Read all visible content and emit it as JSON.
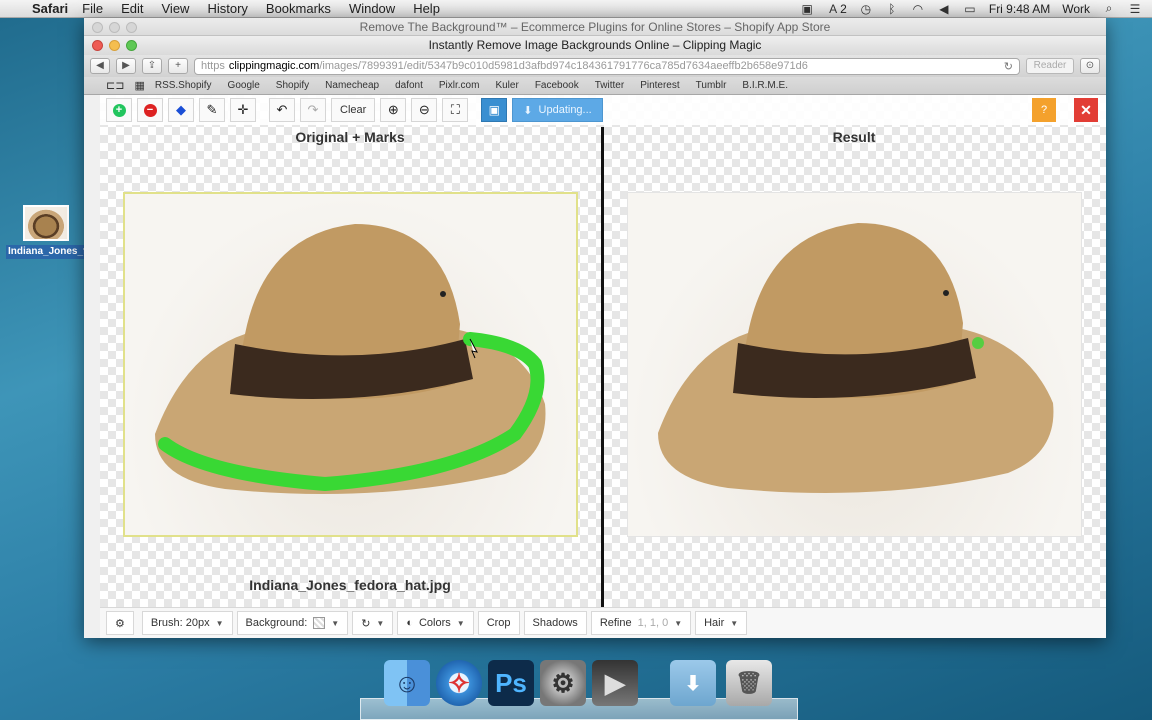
{
  "menubar": {
    "app": "Safari",
    "items": [
      "File",
      "Edit",
      "View",
      "History",
      "Bookmarks",
      "Window",
      "Help"
    ],
    "badge": "2",
    "clock": "Fri 9:48 AM",
    "user": "Work"
  },
  "desktop": {
    "file_label": "Indiana_Jones_fedora_hat.jpg"
  },
  "browser": {
    "background_title": "Remove The Background™ – Ecommerce Plugins for Online Stores – Shopify App Store",
    "window_title": "Instantly Remove Image Backgrounds Online – Clipping Magic",
    "url_scheme": "https",
    "url_host": "clippingmagic.com",
    "url_path": "/images/7899391/edit/5347b9c010d5981d3afbd974c184361791776ca785d7634aeeffb2b658e971d6",
    "reader_label": "Reader",
    "bookmarks": [
      "RSS.Shopify",
      "Google",
      "Shopify",
      "Namecheap",
      "dafont",
      "Pixlr.com",
      "Kuler",
      "Facebook",
      "Twitter",
      "Pinterest",
      "Tumblr",
      "B.I.R.M.E."
    ]
  },
  "app": {
    "clear_label": "Clear",
    "updating_label": "Updating...",
    "help_label": "?",
    "left_title": "Original + Marks",
    "right_title": "Result",
    "filename": "Indiana_Jones_fedora_hat.jpg",
    "bottom": {
      "brush_label": "Brush: 20px",
      "background_label": "Background:",
      "colors_label": "Colors",
      "crop_label": "Crop",
      "shadows_label": "Shadows",
      "refine_label": "Refine",
      "refine_values": "1, 1, 0",
      "hair_label": "Hair"
    }
  },
  "colors": {
    "accent_blue": "#3a8fd1",
    "help_orange": "#f4a12c",
    "close_red": "#e23d35",
    "keep_green": "#22c55e",
    "remove_red": "#d22"
  }
}
